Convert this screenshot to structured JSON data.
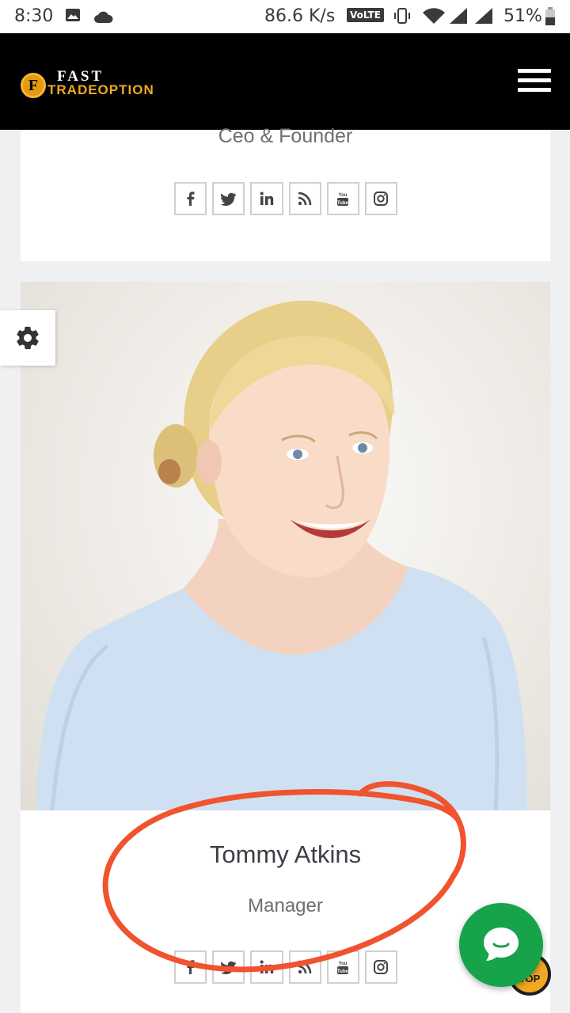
{
  "status_bar": {
    "time": "8:30",
    "speed": "86.6 K/s",
    "volte": "VoLTE",
    "battery": "51%"
  },
  "header": {
    "logo_letter": "F",
    "logo_top": "FAST",
    "logo_bottom": "TRADEOPTION",
    "menu_icon": "hamburger-icon"
  },
  "team": [
    {
      "role": "Ceo & Founder",
      "socials": [
        "facebook",
        "twitter",
        "linkedin",
        "rss",
        "youtube",
        "instagram"
      ]
    },
    {
      "name": "Tommy Atkins",
      "role": "Manager",
      "socials": [
        "facebook",
        "twitter",
        "linkedin",
        "rss",
        "youtube",
        "instagram"
      ]
    }
  ],
  "floating": {
    "settings_icon": "gear-icon",
    "chat_icon": "chat-bubble-icon",
    "top_label": "TOP"
  },
  "colors": {
    "header_bg": "#000000",
    "brand_orange": "#f0a823",
    "chat_green": "#16a34a",
    "annotation_red": "#f0532e"
  }
}
